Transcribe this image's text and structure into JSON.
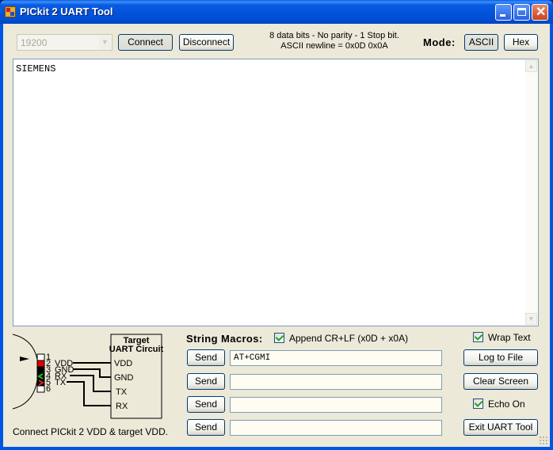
{
  "window": {
    "title": "PICkit 2 UART Tool",
    "controls": {
      "minimize": "minimize",
      "maximize": "maximize",
      "close": "close"
    }
  },
  "toolbar": {
    "baud_rate": "19200",
    "connect_label": "Connect",
    "disconnect_label": "Disconnect",
    "info_line1": "8 data bits - No parity - 1 Stop bit.",
    "info_line2": "ASCII newline = 0x0D 0x0A",
    "mode_label": "Mode:",
    "ascii_label": "ASCII",
    "hex_label": "Hex"
  },
  "terminal": {
    "text": "SIEMENS"
  },
  "diagram": {
    "target_title_line1": "Target",
    "target_title_line2": "UART Circuit",
    "pins": [
      {
        "num": "1",
        "name": ""
      },
      {
        "num": "2",
        "name": "VDD"
      },
      {
        "num": "3",
        "name": "GND"
      },
      {
        "num": "4",
        "name": "RX"
      },
      {
        "num": "5",
        "name": "TX"
      },
      {
        "num": "6",
        "name": ""
      }
    ],
    "target_pins": [
      "VDD",
      "GND",
      "TX",
      "RX"
    ],
    "hint": "Connect PICkit 2 VDD & target VDD."
  },
  "macros": {
    "label": "String Macros:",
    "append_crlf_label": "Append CR+LF (x0D + x0A)",
    "append_crlf_checked": true,
    "send_label": "Send",
    "items": [
      {
        "value": "AT+CGMI"
      },
      {
        "value": ""
      },
      {
        "value": ""
      },
      {
        "value": ""
      }
    ]
  },
  "side": {
    "wrap_text_label": "Wrap Text",
    "wrap_text_checked": true,
    "log_to_file_label": "Log to File",
    "clear_screen_label": "Clear Screen",
    "echo_on_label": "Echo On",
    "echo_on_checked": true,
    "exit_label": "Exit UART Tool"
  }
}
